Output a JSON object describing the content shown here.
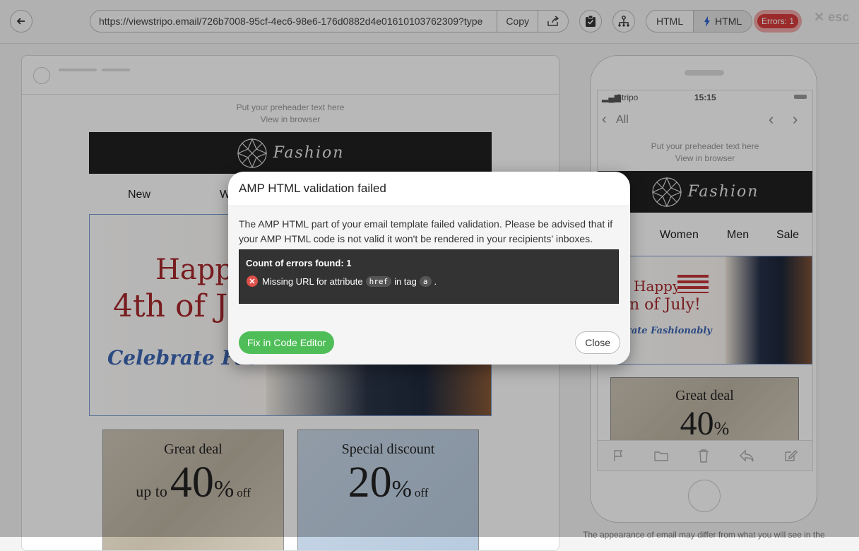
{
  "toolbar": {
    "url": "https://viewstripo.email/726b7008-95cf-4ec6-98e6-176d0882d4e01610103762309?type",
    "copy_label": "Copy",
    "format_html": "HTML",
    "format_amp": "HTML",
    "errors_label": "Errors: 1",
    "esc_label": "esc",
    "esc_icon": "✕"
  },
  "email": {
    "preheader": "Put your preheader text here",
    "view_in_browser": "View in browser",
    "brand": "Fashion",
    "menu": [
      "New",
      "Women",
      "Men",
      "Sale"
    ],
    "menu_visible_left": [
      "New",
      "W"
    ],
    "hero": {
      "line1": "Happy",
      "line2": "4th of July!",
      "line2_desktop": "4th of Ju",
      "line2_phone": "n of July!",
      "tagline": "Celebrate Fashionably",
      "tagline_desktop": "Celebrate Fashio",
      "tagline_phone": "rate Fashionably"
    },
    "cards": [
      {
        "title": "Great deal",
        "prefix": "up to",
        "value": "40",
        "pct": "%",
        "suffix": "off"
      },
      {
        "title": "Special discount",
        "prefix": "",
        "value": "20",
        "pct": "%",
        "suffix": "off"
      }
    ],
    "phone_card": {
      "title": "Great deal",
      "value": "40",
      "pct": "%"
    }
  },
  "phone": {
    "carrier": "Stripo",
    "time": "15:15",
    "back_label": "All"
  },
  "footer_note": "The appearance of email may differ from what you will see in the",
  "modal": {
    "title": "AMP HTML validation failed",
    "message": "The AMP HTML part of your email template failed validation. Please be advised that if your AMP HTML code is not valid it won't be rendered in your recipients' inboxes.",
    "count_label": "Count of errors found: 1",
    "error": {
      "text_before": "Missing URL for attribute",
      "attr": "href",
      "text_mid": "in tag",
      "tag": "a",
      "text_after": "."
    },
    "fix_label": "Fix in Code Editor",
    "close_label": "Close"
  },
  "colors": {
    "fix_button": "#4fbe58",
    "error_badge": "#d73b3b",
    "hero_red": "#a7282c",
    "hero_blue": "#3e67b4"
  }
}
